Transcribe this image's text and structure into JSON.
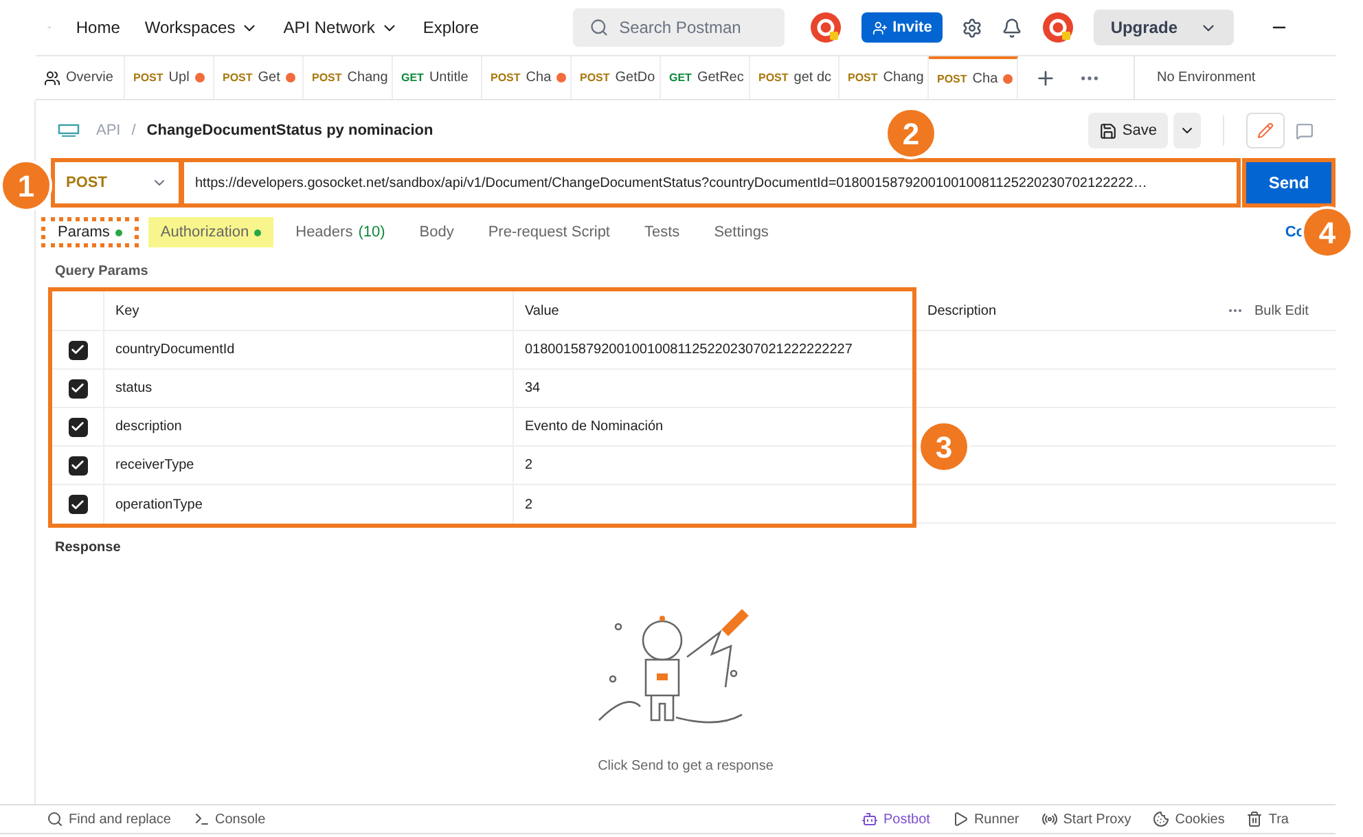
{
  "nav": {
    "items": [
      {
        "label": "Home",
        "dropdown": false
      },
      {
        "label": "Workspaces",
        "dropdown": true
      },
      {
        "label": "API Network",
        "dropdown": true
      },
      {
        "label": "Explore",
        "dropdown": false
      }
    ],
    "search": {
      "placeholder": "Search Postman"
    },
    "invite": "Invite",
    "upgrade": "Upgrade"
  },
  "tabs": [
    {
      "kind": "overview",
      "name": "Overvie",
      "unsaved": false,
      "selected": false
    },
    {
      "kind": "request",
      "method": "POST",
      "name": "Upl",
      "unsaved": true,
      "selected": false
    },
    {
      "kind": "request",
      "method": "POST",
      "name": "Get",
      "unsaved": true,
      "selected": false
    },
    {
      "kind": "request",
      "method": "POST",
      "name": "Chang",
      "unsaved": false,
      "selected": false
    },
    {
      "kind": "request",
      "method": "GET",
      "name": "Untitle",
      "unsaved": false,
      "selected": false
    },
    {
      "kind": "request",
      "method": "POST",
      "name": "Cha",
      "unsaved": true,
      "selected": false
    },
    {
      "kind": "request",
      "method": "POST",
      "name": "GetDo",
      "unsaved": false,
      "selected": false
    },
    {
      "kind": "request",
      "method": "GET",
      "name": "GetRec",
      "unsaved": false,
      "selected": false
    },
    {
      "kind": "request",
      "method": "POST",
      "name": "get dc",
      "unsaved": false,
      "selected": false
    },
    {
      "kind": "request",
      "method": "POST",
      "name": "Chang",
      "unsaved": false,
      "selected": false
    },
    {
      "kind": "request",
      "method": "POST",
      "name": "Cha",
      "unsaved": true,
      "selected": true
    }
  ],
  "environment": "No Environment",
  "breadcrumb": {
    "parent": "API",
    "separator": "/",
    "title": "ChangeDocumentStatus py nominacion"
  },
  "save": "Save",
  "request": {
    "method": "POST",
    "url": "https://developers.gosocket.net/sandbox/api/v1/Document/ChangeDocumentStatus?countryDocumentId=018001587920010010081125220230702122222…",
    "send": "Send"
  },
  "request_tabs": [
    {
      "label": "Params",
      "dot": true,
      "selected": true,
      "highlighted": false,
      "outlined": true
    },
    {
      "label": "Authorization",
      "dot": true,
      "selected": false,
      "highlighted": true,
      "outlined": false
    },
    {
      "label": "Headers",
      "count": "(10)",
      "dot": false,
      "selected": false,
      "highlighted": false,
      "outlined": false
    },
    {
      "label": "Body",
      "dot": false,
      "selected": false,
      "highlighted": false,
      "outlined": false
    },
    {
      "label": "Pre-request Script",
      "dot": false,
      "selected": false,
      "highlighted": false,
      "outlined": false
    },
    {
      "label": "Tests",
      "dot": false,
      "selected": false,
      "highlighted": false,
      "outlined": false
    },
    {
      "label": "Settings",
      "dot": false,
      "selected": false,
      "highlighted": false,
      "outlined": false
    }
  ],
  "cookies_link": "Co",
  "query_params": {
    "title": "Query Params",
    "columns": [
      "Key",
      "Value",
      "Description"
    ],
    "bulk_edit": "Bulk Edit",
    "rows": [
      {
        "checked": true,
        "key": "countryDocumentId",
        "value": "0180015879200100100811252202307021222222227"
      },
      {
        "checked": true,
        "key": "status",
        "value": "34"
      },
      {
        "checked": true,
        "key": "description",
        "value": "Evento de Nominación"
      },
      {
        "checked": true,
        "key": "receiverType",
        "value": "2"
      },
      {
        "checked": true,
        "key": "operationType",
        "value": "2"
      }
    ]
  },
  "response": {
    "title": "Response",
    "empty_message": "Click Send to get a response"
  },
  "status_bar": {
    "left": [
      {
        "kind": "find",
        "label": "Find and replace"
      },
      {
        "kind": "console",
        "label": "Console"
      }
    ],
    "right": [
      {
        "kind": "postbot",
        "label": "Postbot"
      },
      {
        "kind": "runner",
        "label": "Runner"
      },
      {
        "kind": "proxy",
        "label": "Start Proxy"
      },
      {
        "kind": "cookies",
        "label": "Cookies"
      },
      {
        "kind": "trash",
        "label": "Tra"
      }
    ]
  },
  "callouts": {
    "method": "1",
    "url": "2",
    "params": "3",
    "send": "4"
  }
}
